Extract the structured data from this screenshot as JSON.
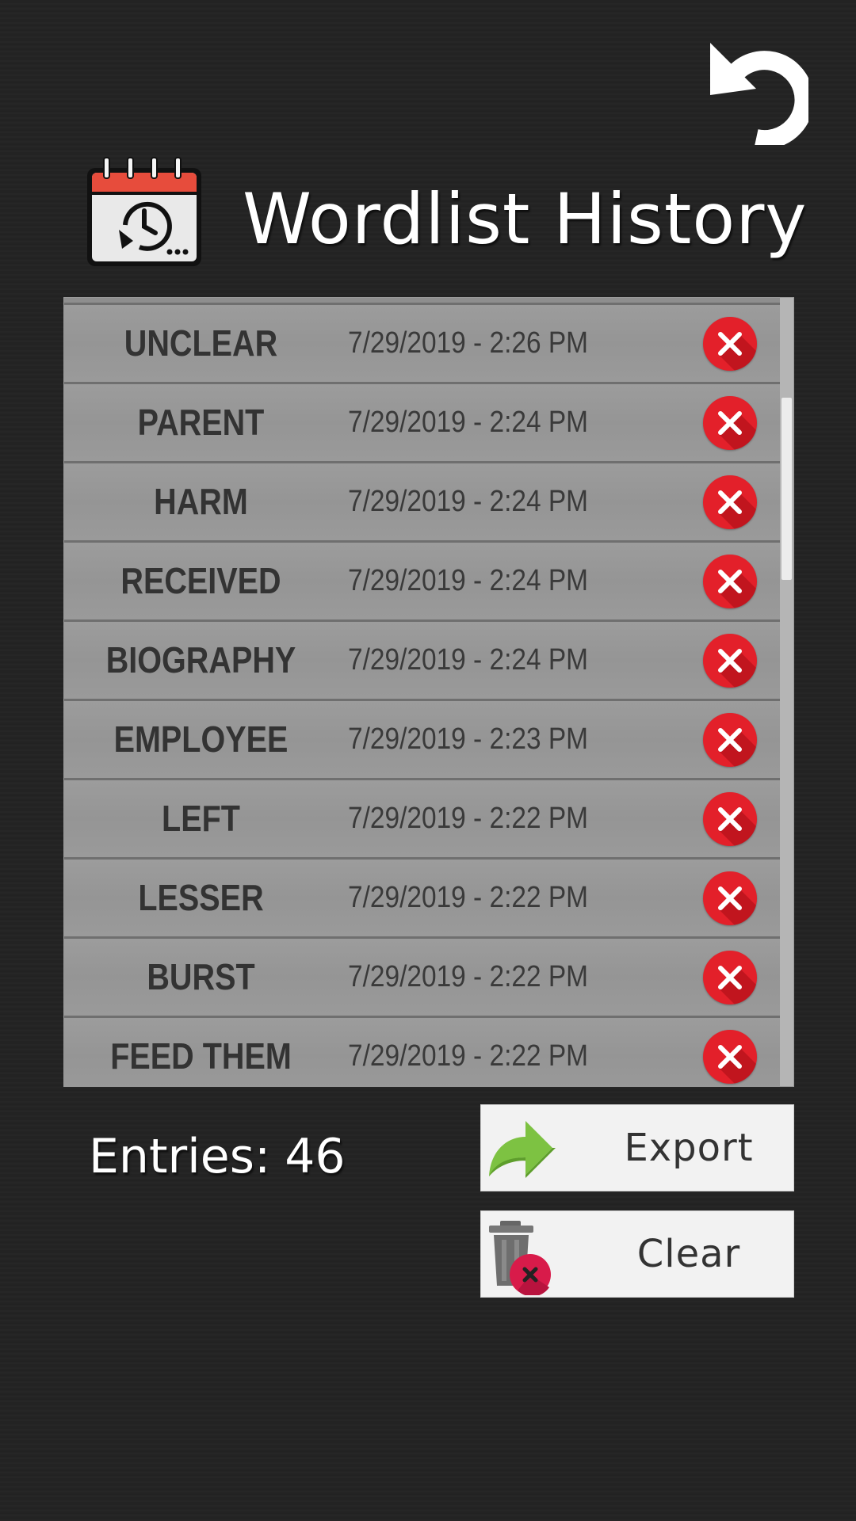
{
  "header": {
    "title": "Wordlist History",
    "back_icon": "undo-arrow-icon",
    "title_icon": "calendar-history-icon"
  },
  "list": {
    "rows": [
      {
        "word": "UNCLEAR",
        "date": "7/29/2019 - 2:26 PM"
      },
      {
        "word": "PARENT",
        "date": "7/29/2019 - 2:24 PM"
      },
      {
        "word": "HARM",
        "date": "7/29/2019 - 2:24 PM"
      },
      {
        "word": "RECEIVED",
        "date": "7/29/2019 - 2:24 PM"
      },
      {
        "word": "BIOGRAPHY",
        "date": "7/29/2019 - 2:24 PM"
      },
      {
        "word": "EMPLOYEE",
        "date": "7/29/2019 - 2:23 PM"
      },
      {
        "word": "LEFT",
        "date": "7/29/2019 - 2:22 PM"
      },
      {
        "word": "LESSER",
        "date": "7/29/2019 - 2:22 PM"
      },
      {
        "word": "BURST",
        "date": "7/29/2019 - 2:22 PM"
      },
      {
        "word": "FEED THEM",
        "date": "7/29/2019 - 2:22 PM"
      }
    ],
    "delete_icon": "close-circle-icon"
  },
  "footer": {
    "entries_label": "Entries:",
    "entries_count": "46",
    "export_label": "Export",
    "clear_label": "Clear"
  },
  "colors": {
    "background": "#232323",
    "panel": "#8e8e8e",
    "delete_red": "#e3202a",
    "export_green": "#7dc242",
    "clear_badge": "#d81b4a"
  }
}
